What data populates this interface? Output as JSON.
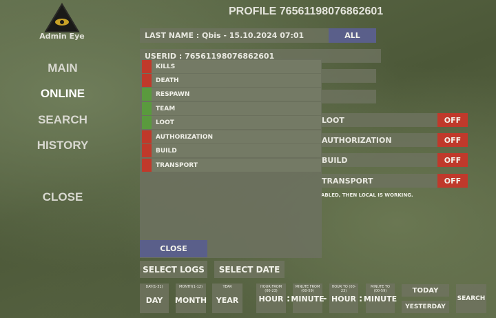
{
  "brand": {
    "logo_text": "Admin Eye"
  },
  "profile_title": "PROFILE 76561198076862601",
  "nav": [
    {
      "label": "MAIN"
    },
    {
      "label": "ONLINE"
    },
    {
      "label": "SEARCH"
    },
    {
      "label": "HISTORY"
    },
    {
      "label": "CLOSE"
    }
  ],
  "header": {
    "last_name": "LAST NAME : Qbis - 15.10.2024 07:01",
    "all_label": "ALL"
  },
  "userid_text": "USERID : 76561198076862601",
  "toggles": [
    {
      "label": "LOOT",
      "state": "OFF"
    },
    {
      "label": "AUTHORIZATION",
      "state": "OFF"
    },
    {
      "label": "BUILD",
      "state": "OFF"
    },
    {
      "label": "TRANSPORT",
      "state": "OFF"
    }
  ],
  "note_text": "ABLED, THEN LOCAL IS WORKING.",
  "log_types": [
    {
      "label": "KILLS",
      "enabled": false
    },
    {
      "label": "DEATH",
      "enabled": false
    },
    {
      "label": "RESPAWN",
      "enabled": true
    },
    {
      "label": "TEAM",
      "enabled": true
    },
    {
      "label": "LOOT",
      "enabled": true
    },
    {
      "label": "AUTHORIZATION",
      "enabled": false
    },
    {
      "label": "BUILD",
      "enabled": false
    },
    {
      "label": "TRANSPORT",
      "enabled": false
    }
  ],
  "popup_close": "CLOSE",
  "select_logs": "SELECT LOGS",
  "select_date": "SELECT DATE",
  "date_fields": {
    "day": {
      "caption": "DAY(1-31)",
      "value": "DAY"
    },
    "month": {
      "caption": "MONTH(1-12)",
      "value": "MONTH"
    },
    "year": {
      "caption": "YEAR",
      "value": "YEAR"
    },
    "hour_from": {
      "caption": "HOUR FROM (00-23)",
      "value": "HOUR"
    },
    "minute_from": {
      "caption": "MINUTE FROM (00-59)",
      "value": "MINUTE"
    },
    "hour_to": {
      "caption": "HOUR TO (00-23)",
      "value": "HOUR"
    },
    "minute_to": {
      "caption": "MINUTE TO (00-59)",
      "value": "MINUTE"
    }
  },
  "separators": {
    "colon": ":",
    "dash": "-"
  },
  "today": "TODAY",
  "yesterday": "YESTERDAY",
  "search": "SEARCH",
  "colors": {
    "enabled": "#5a9a3e",
    "disabled": "#c0392b",
    "accent": "#5a5f8a"
  }
}
